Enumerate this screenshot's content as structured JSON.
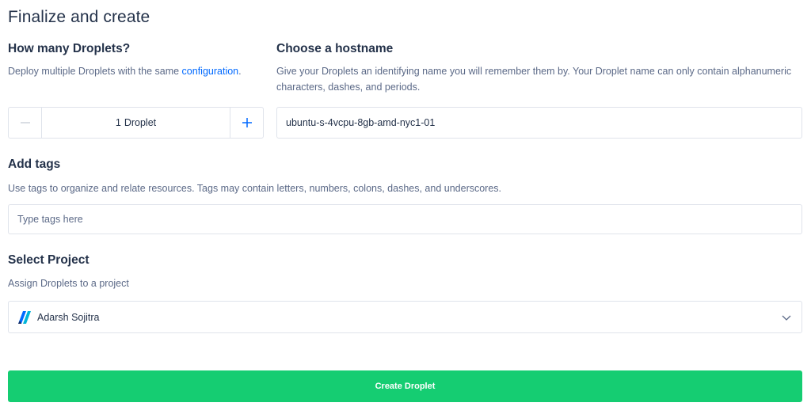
{
  "page": {
    "title": "Finalize and create"
  },
  "droplets": {
    "heading": "How many Droplets?",
    "desc_prefix": "Deploy multiple Droplets with the same ",
    "desc_link": "configuration",
    "desc_suffix": ".",
    "count": "1",
    "unit": "Droplet",
    "minus_icon": "minus-icon",
    "plus_icon": "plus-icon"
  },
  "hostname": {
    "heading": "Choose a hostname",
    "desc": "Give your Droplets an identifying name you will remember them by. Your Droplet name can only contain alphanumeric characters, dashes, and periods.",
    "value": "ubuntu-s-4vcpu-8gb-amd-nyc1-01"
  },
  "tags": {
    "heading": "Add tags",
    "desc": "Use tags to organize and relate resources. Tags may contain letters, numbers, colons, dashes, and underscores.",
    "placeholder": "Type tags here"
  },
  "project": {
    "heading": "Select Project",
    "desc": "Assign Droplets to a project",
    "selected": "Adarsh Sojitra",
    "logo_icon": "project-logo-icon",
    "chevron_icon": "chevron-down-icon"
  },
  "actions": {
    "create_label": "Create Droplet"
  },
  "colors": {
    "accent": "#0069ff",
    "create_button": "#15cd72",
    "heading": "#24324a",
    "muted": "#5b6987",
    "border": "#dfe3eb"
  }
}
